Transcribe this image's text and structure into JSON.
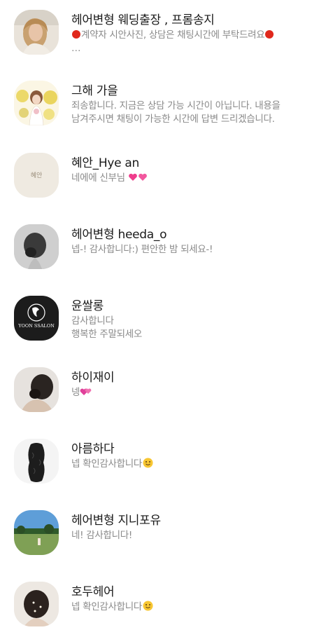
{
  "chats": [
    {
      "name": "헤어변형 웨딩출장 , 프롬송지",
      "lines": [
        "계약자 시안사진, 상담은 채팅시간에 부탁드려요",
        "…"
      ],
      "avatar": "woman-portrait-avatar"
    },
    {
      "name": "그해 가을",
      "lines": [
        "죄송합니다. 지금은 상담 가능 시간이 아닙니다. 내용을",
        "남겨주시면 채팅이 가능한 시간에 답변 드리겠습니다."
      ],
      "avatar": "bride-illustration-avatar"
    },
    {
      "name": "혜안_Hye an",
      "lines": [
        "네에에 신부님"
      ],
      "avatar": "logo-avatar",
      "logo_text": "혜안"
    },
    {
      "name": "헤어변형 heeda_o",
      "lines": [
        "넵-! 감사합니다:) 편안한 밤 되세요-!"
      ],
      "avatar": "hair-bun-avatar"
    },
    {
      "name": "윤쌀롱",
      "lines": [
        "감사합니다",
        "행복한 주말되세오"
      ],
      "avatar": "salon-logo-avatar",
      "logo_text": "YOON SSALON"
    },
    {
      "name": "하이재이",
      "lines": [
        "넹"
      ],
      "avatar": "updo-avatar"
    },
    {
      "name": "아름하다",
      "lines": [
        "넵 확인감사합니다"
      ],
      "avatar": "wavy-hair-avatar"
    },
    {
      "name": "헤어변형 지니포유",
      "lines": [
        "네! 감사합니다!"
      ],
      "avatar": "landscape-avatar"
    },
    {
      "name": "호두헤어",
      "lines": [
        "넵 확인감사합니다"
      ],
      "avatar": "hair-pin-avatar"
    }
  ]
}
